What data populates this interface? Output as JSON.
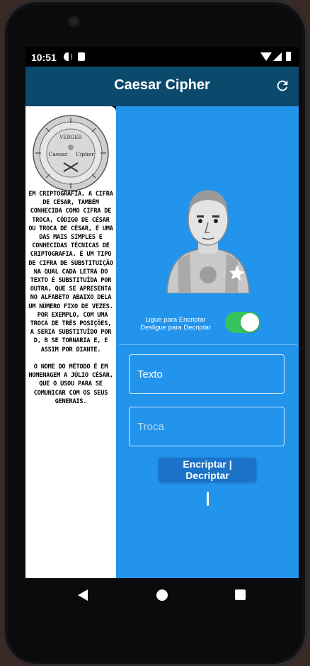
{
  "status_bar": {
    "time": "10:51"
  },
  "app_bar": {
    "title": "Caesar Cipher",
    "refresh_icon": "refresh-icon"
  },
  "side_panel": {
    "coin_text": {
      "top": "VERGER",
      "left": "Caesar",
      "right": "Cipher"
    },
    "description": "Em criptografia, a cifra de César, também conhecida como cifra de troca, código de César ou troca de César, é uma das mais simples e conhecidas técnicas de criptografia. É um tipo de cifra de substituição na qual cada letra do texto é substituída por outra, que se apresenta no alfabeto abaixo dela um número fixo de vezes.\n Por exemplo, com uma troca de três posições, A seria substituído por D, B se tornaria E, e assim por diante.\n\nO nome do método é em homenagem a Júlio César, que o usou para se comunicar com os seus generais."
  },
  "main": {
    "toggle_label_on": "Ligue para Encriptar",
    "toggle_label_off": "Desligue para Decriptar",
    "toggle_on": true,
    "text_placeholder": "Texto",
    "shift_placeholder": "Troca",
    "button_label": "Encriptar | Decriptar"
  },
  "colors": {
    "app_bar": "#0b4a6c",
    "panel": "#2294ec",
    "button": "#1b72c9",
    "switch_on": "#36c25c"
  }
}
